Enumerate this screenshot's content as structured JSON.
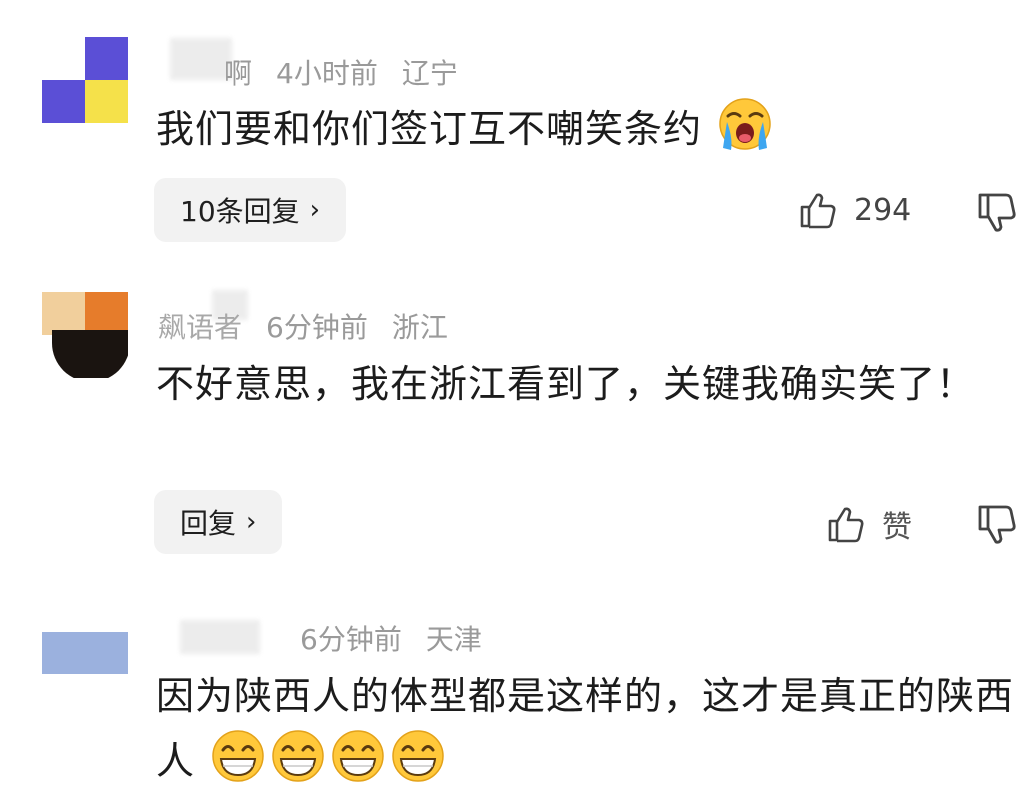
{
  "comments": [
    {
      "name": "啊",
      "time": "4小时前",
      "location": "辽宁",
      "text": "我们要和你们签订互不嘲笑条约",
      "emoji": [
        "loudly-crying-face"
      ],
      "reply_label": "10条回复",
      "likes": "294",
      "avatar_colors": [
        "#ffffff",
        "#5b4fd6",
        "#5b4fd6",
        "#f5e14a"
      ]
    },
    {
      "name": "飙语者",
      "time": "6分钟前",
      "location": "浙江",
      "text": "不好意思，我在浙江看到了，关键我确实笑了！",
      "emoji": [],
      "reply_label": "回复",
      "likes": "赞",
      "avatar_colors": [
        "#f1cf9c",
        "#e67c2b",
        "#1a1410",
        "#2a2018"
      ]
    },
    {
      "name": "",
      "time": "6分钟前",
      "location": "天津",
      "text": "因为陕西人的体型都是这样的，这才是真正的陕西人",
      "emoji": [
        "grinning-face",
        "grinning-face",
        "grinning-face",
        "grinning-face"
      ]
    }
  ],
  "icons": {
    "reply_chevron": "›",
    "like": "thumbs-up-icon",
    "dislike": "thumbs-down-icon"
  }
}
